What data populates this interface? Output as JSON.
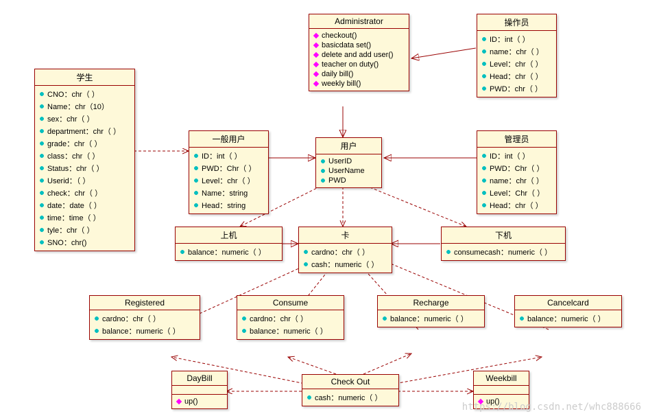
{
  "watermark": "https://blog.csdn.net/whc888666",
  "classes": {
    "administrator": {
      "title": "Administrator",
      "ops": [
        "checkout()",
        "basicdata set()",
        "delete and add user()",
        "teacher on duty()",
        "daily bill()",
        "weekly bill()"
      ]
    },
    "operator": {
      "title": "操作员",
      "attrs": [
        "ID：int（ ）",
        "name：chr（ ）",
        "Level：chr（ ）",
        "Head：chr（ ）",
        "PWD：chr（ ）"
      ]
    },
    "student": {
      "title": "学生",
      "attrs": [
        "CNO：chr（ ）",
        "Name：chr（10）",
        "sex：chr（ ）",
        "department：chr（ ）",
        "grade：chr（ ）",
        "class：chr（ ）",
        "Status：chr（ ）",
        "Userid：（ ）",
        "check：chr（ ）",
        "date：date（ ）",
        "time：time（ ）",
        "tyle：chr（ ）",
        "SNO：chr()"
      ]
    },
    "general": {
      "title": "一般用户",
      "attrs": [
        "ID：int（ ）",
        "PWD：Chr（ ）",
        "Level：chr（ ）",
        "Name：string",
        "Head：string"
      ]
    },
    "user": {
      "title": "用户",
      "attrs": [
        "UserID",
        "UserName",
        "PWD"
      ]
    },
    "admin2": {
      "title": "管理员",
      "attrs": [
        "ID：int（ ）",
        "PWD：Chr（ ）",
        "name：chr（ ）",
        "Level：Chr（ ）",
        "Head：chr（ ）"
      ]
    },
    "online": {
      "title": "上机",
      "attrs": [
        "balance：numeric（ ）"
      ]
    },
    "card": {
      "title": "卡",
      "attrs": [
        "cardno：chr（ ）",
        "cash：numeric（ ）"
      ]
    },
    "offline": {
      "title": "下机",
      "attrs": [
        "consumecash：numeric（ ）"
      ]
    },
    "registered": {
      "title": "Registered",
      "attrs": [
        "cardno：chr（ ）",
        "balance：numeric（ ）"
      ]
    },
    "consume": {
      "title": "Consume",
      "attrs": [
        "cardno：chr（ ）",
        "balance：numeric（ ）"
      ]
    },
    "recharge": {
      "title": "Recharge",
      "attrs": [
        "balance：numeric（ ）"
      ]
    },
    "cancelcard": {
      "title": "Cancelcard",
      "attrs": [
        "balance：numeric（ ）"
      ]
    },
    "daybill": {
      "title": "DayBill",
      "ops": [
        "up()"
      ]
    },
    "checkout": {
      "title": "Check Out",
      "attrs": [
        "cash：numeric（ ）"
      ]
    },
    "weekbill": {
      "title": "Weekbill",
      "ops": [
        "up()"
      ]
    }
  }
}
